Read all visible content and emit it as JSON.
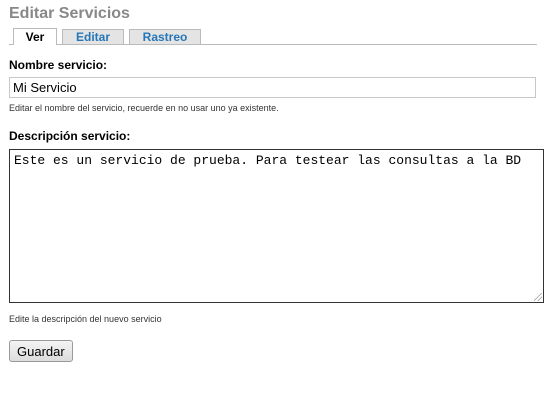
{
  "page": {
    "title": "Editar Servicios"
  },
  "tabs": [
    {
      "label": "Ver",
      "active": true
    },
    {
      "label": "Editar",
      "active": false
    },
    {
      "label": "Rastreo",
      "active": false
    }
  ],
  "form": {
    "name": {
      "label": "Nombre servicio:",
      "value": "Mi Servicio",
      "help": "Editar el nombre del servicio, recuerde en no usar uno ya existente."
    },
    "description": {
      "label": "Descripción servicio:",
      "value": "Este es un servicio de prueba. Para testear las consultas a la BD",
      "help": "Edite la descripción del nuevo servicio"
    },
    "save_label": "Guardar"
  },
  "colors": {
    "title": "#888888",
    "tab_link": "#2777b8",
    "tab_inactive_bg": "#e4e4e4"
  }
}
